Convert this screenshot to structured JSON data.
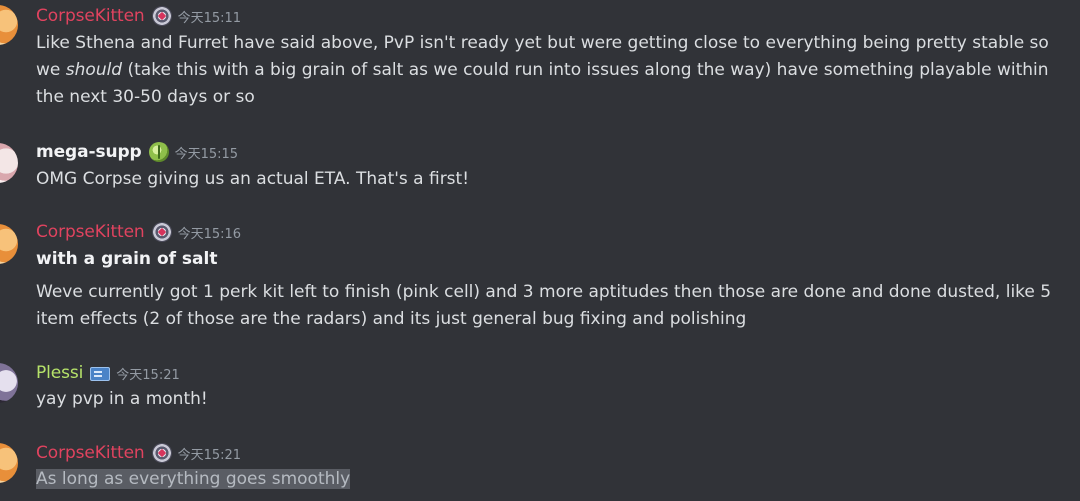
{
  "messages": [
    {
      "username": "CorpseKitten",
      "timestamp": "今天15:11",
      "badge_icon": "hexagon-badge-icon",
      "text_before": "Like Sthena and Furret have said above, PvP isn't ready yet but were getting close to everything being pretty stable so we ",
      "text_italic": "should",
      "text_after": " (take this with a big grain of salt as we could run into issues along the way) have something playable within the next 30-50 days or so"
    },
    {
      "username": "mega-supp",
      "timestamp": "今天15:15",
      "badge_icon": "melon-badge-icon",
      "text": "OMG Corpse giving us an actual ETA. That's a first!"
    },
    {
      "username": "CorpseKitten",
      "timestamp": "今天15:16",
      "badge_icon": "hexagon-badge-icon",
      "bold_line": "with a grain of salt",
      "text": "Weve currently got 1 perk kit left to finish (pink cell) and 3 more aptitudes then those are done and done dusted, like 5 item effects (2 of those are the radars) and its just general bug fixing and polishing"
    },
    {
      "username": "Plessi",
      "timestamp": "今天15:21",
      "badge_icon": "id-card-badge-icon",
      "text": "yay pvp in a month!"
    },
    {
      "username": "CorpseKitten",
      "timestamp": "今天15:21",
      "badge_icon": "hexagon-badge-icon",
      "text": "As long as everything goes smoothly"
    }
  ],
  "colors": {
    "background": "#313338",
    "corpse_name": "#e0435f",
    "plessi_name": "#b6e36a",
    "timestamp": "#949ba4",
    "text": "#dbdee1"
  }
}
